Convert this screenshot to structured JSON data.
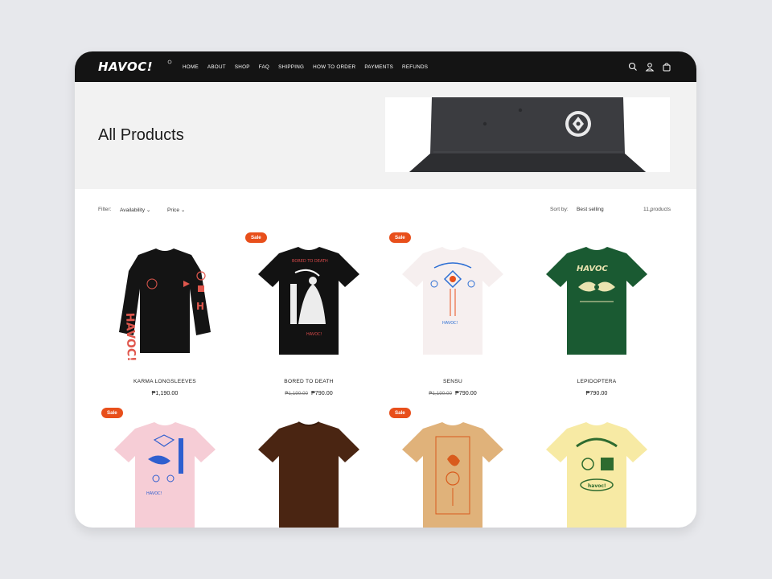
{
  "header": {
    "logo_text": "HAVOC!",
    "nav": [
      "HOME",
      "ABOUT",
      "SHOP",
      "FAQ",
      "SHIPPING",
      "HOW TO ORDER",
      "PAYMENTS",
      "REFUNDS"
    ],
    "icons": [
      "search-icon",
      "account-icon",
      "cart-icon"
    ]
  },
  "banner": {
    "title": "All Products"
  },
  "filters": {
    "label": "Filter:",
    "availability": "Availability",
    "price": "Price",
    "sort_label": "Sort by:",
    "sort_value": "Best selling",
    "count": "11 products"
  },
  "products": [
    {
      "name": "KARMA LONGSLEEVES",
      "sale": "",
      "old_price": "",
      "price": "₱1,190.00",
      "color": "#141414",
      "accent": "#e0574d"
    },
    {
      "name": "BORED TO DEATH",
      "sale": "Sale",
      "old_price": "₱1,190.00",
      "price": "₱790.00",
      "color": "#121212",
      "accent": "#d94a4a"
    },
    {
      "name": "SENSU",
      "sale": "Sale",
      "old_price": "₱1,190.00",
      "price": "₱790.00",
      "color": "#f6efef",
      "accent": "#2d6fd4"
    },
    {
      "name": "LEPIDOPTERA",
      "sale": "",
      "old_price": "",
      "price": "₱790.00",
      "color": "#1a5a32",
      "accent": "#e9e3b0"
    },
    {
      "name": "",
      "sale": "Sale",
      "old_price": "",
      "price": "",
      "color": "#f6cdd6",
      "accent": "#2f5fcf"
    },
    {
      "name": "",
      "sale": "",
      "old_price": "",
      "price": "",
      "color": "#4a2512",
      "accent": "#3a1c0c"
    },
    {
      "name": "",
      "sale": "Sale",
      "old_price": "",
      "price": "",
      "color": "#e0b27a",
      "accent": "#d95b1d"
    },
    {
      "name": "",
      "sale": "",
      "old_price": "",
      "price": "",
      "color": "#f7eaa4",
      "accent": "#2e6b2f"
    }
  ]
}
